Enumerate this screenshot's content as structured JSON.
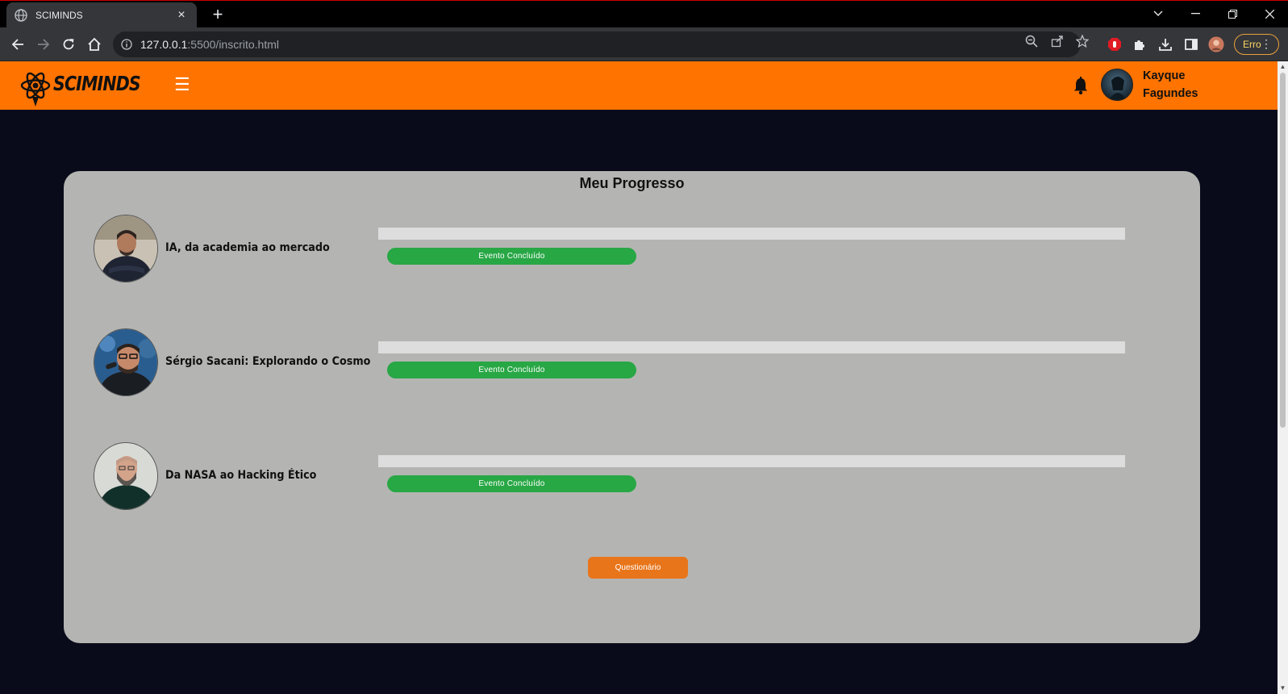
{
  "browser": {
    "tab_title": "SCIMINDS",
    "url_host": "127.0.0.1",
    "url_path": ":5500/inscrito.html",
    "error_label": "Erro",
    "new_tab_glyph": "+",
    "tab_close_glyph": "×"
  },
  "header": {
    "logo_text": "SCIMINDS",
    "menu_glyph": "☰",
    "user_name": "Kayque Fagundes"
  },
  "progress": {
    "title": "Meu Progresso",
    "events": [
      {
        "name": "IA, da academia ao mercado",
        "status": "Evento Concluído"
      },
      {
        "name": "Sérgio Sacani: Explorando o Cosmo",
        "status": "Evento Concluído"
      },
      {
        "name": "Da NASA ao Hacking Ético",
        "status": "Evento Concluído"
      }
    ],
    "quiz_label": "Questionário"
  },
  "colors": {
    "header_orange": "#ff7300",
    "page_bg": "#0a0b1a",
    "card_bg": "#b4b5b2",
    "status_green": "#28a745",
    "quiz_orange": "#e8751a"
  },
  "icons": [
    "globe-icon",
    "back-icon",
    "forward-icon",
    "reload-icon",
    "home-icon",
    "info-icon",
    "zoom-icon",
    "share-icon",
    "star-icon",
    "extension-icon",
    "download-icon",
    "sidepanel-icon",
    "bell-icon",
    "atom-logo-icon",
    "hamburger-icon"
  ]
}
